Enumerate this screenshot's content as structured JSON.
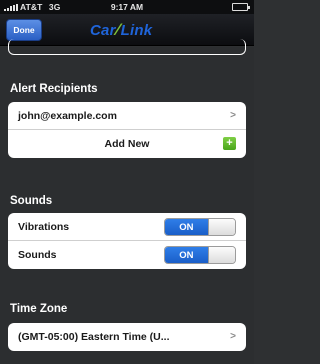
{
  "status_bar": {
    "carrier": "AT&T",
    "network": "3G",
    "time": "9:17 AM"
  },
  "nav": {
    "done_label": "Done",
    "logo_part1": "Car",
    "logo_part2": "Link"
  },
  "alerts": {
    "header": "Alert Recipients",
    "recipients": [
      "john@example.com"
    ],
    "add_new_label": "Add New"
  },
  "sounds": {
    "header": "Sounds",
    "items": [
      {
        "label": "Vibrations",
        "state": "ON"
      },
      {
        "label": "Sounds",
        "state": "ON"
      }
    ]
  },
  "timezone": {
    "header": "Time Zone",
    "value": "(GMT-05:00) Eastern Time (U..."
  },
  "colors": {
    "accent": "#1f64d9",
    "toggle_on": "#2f7ee8",
    "add_icon": "#5fbd2c"
  }
}
